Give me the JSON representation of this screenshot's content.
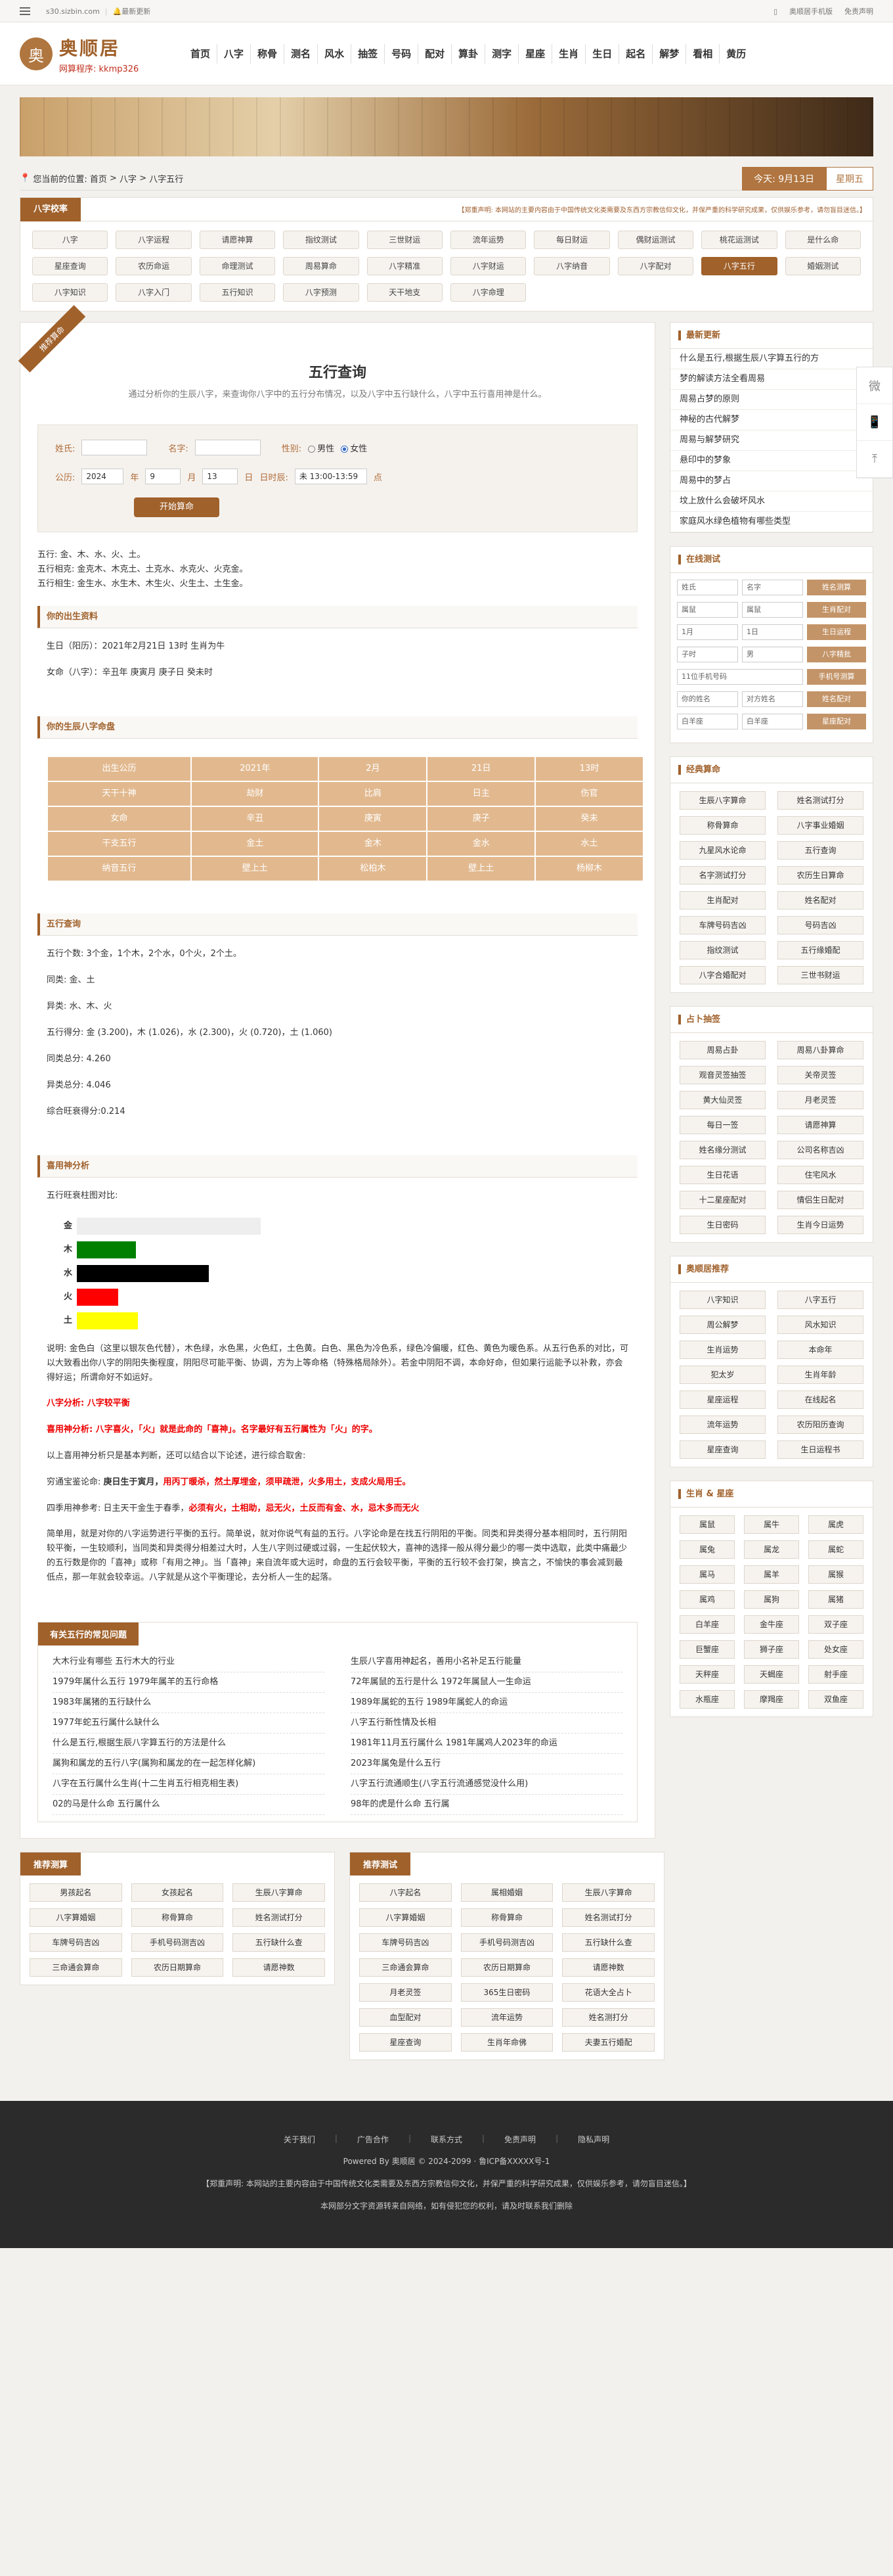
{
  "topbar": {
    "site": "s30.sizbin.com",
    "latest": "最新更新",
    "mobile": "奥顺居手机版",
    "statement": "免责声明"
  },
  "header": {
    "logo_mark": "奥",
    "logo_name": "奥顺居",
    "logo_sub": "网算程序: kkmp326",
    "nav": [
      "首页",
      "八字",
      "称骨",
      "测名",
      "风水",
      "抽签",
      "号码",
      "配对",
      "算卦",
      "测字",
      "星座",
      "生肖",
      "生日",
      "起名",
      "解梦",
      "看相",
      "黄历"
    ]
  },
  "crumb": {
    "label": "您当前的位置:",
    "path": [
      "首页",
      "八字",
      "八字五行"
    ],
    "today": "今天: 9月13日",
    "weekday": "星期五"
  },
  "bazi_panel": {
    "tag": "八字校率",
    "note": "【郑重声明: 本网站的主要内容由于中国传统文化类需要及东西方宗教信仰文化，并保严重的科学研究成果，仅供娱乐参考，请勿盲目迷信。】",
    "items": [
      "八字",
      "八字运程",
      "请愿神算",
      "指纹测试",
      "三世财运",
      "流年运势",
      "每日财运",
      "偶财运测试",
      "桃花运测试",
      "是什么命",
      "星座查询",
      "农历命运",
      "命理测试",
      "周易算命",
      "八字精准",
      "八字财运",
      "八字纳音",
      "八字配对",
      "八字五行",
      "婚姻测试",
      "八字知识",
      "八字入门",
      "五行知识",
      "八字预测",
      "天干地支",
      "八字命理"
    ],
    "active": "八字五行"
  },
  "main": {
    "corner": "推荐算命",
    "title": "五行查询",
    "subtitle": "通过分析你的生辰八字，来查询你八字中的五行分布情况，以及八字中五行缺什么，八字中五行喜用神是什么。",
    "form": {
      "surname": "姓氏:",
      "name": "名字:",
      "gender": "性别:",
      "male": "男性",
      "female": "女性",
      "calendar": "公历:",
      "year": "2024",
      "year_u": "年",
      "month": "9",
      "month_u": "月",
      "day": "13",
      "day_u": "日",
      "time_label": "日时辰:",
      "time": "未 13:00-13:59",
      "time_u": "点",
      "submit": "开始算命"
    },
    "wuxing": [
      "五行: 金、木、水、火、土。",
      "五行相克: 金克木、木克土、土克水、水克火、火克金。",
      "五行相生: 金生水、水生木、木生火、火生土、土生金。"
    ],
    "sec1": {
      "title": "你的出生资料",
      "birth": "生日（阳历）：2021年2月21日 13时 生肖为牛",
      "bazi": "女命（八字）：辛丑年 庚寅月 庚子日 癸未时"
    },
    "sec2": {
      "title": "你的生辰八字命盘",
      "rows": [
        [
          "出生公历",
          "2021年",
          "2月",
          "21日",
          "13时"
        ],
        [
          "天干十神",
          "劫财",
          "比肩",
          "日主",
          "伤官"
        ],
        [
          "女命",
          "辛丑",
          "庚寅",
          "庚子",
          "癸未"
        ],
        [
          "干支五行",
          "金土",
          "金木",
          "金水",
          "水土"
        ],
        [
          "纳音五行",
          "壁上土",
          "松柏木",
          "壁上土",
          "杨柳木"
        ]
      ]
    },
    "sec3": {
      "title": "五行查询",
      "lines": [
        "五行个数: 3个金，1个木，2个水，0个火，2个土。",
        "同类: 金、土",
        "异类: 水、木、火",
        "五行得分: 金 (3.200)，木 (1.026)，水 (2.300)，火 (0.720)，土 (1.060)",
        "同类总分: 4.260",
        "异类总分: 4.046",
        "综合旺衰得分:0.214"
      ]
    },
    "sec4": {
      "title": "喜用神分析",
      "chart_label": "五行旺衰柱图对比:",
      "desc": "说明: 金色白（这里以银灰色代替），木色绿，水色黑，火色红，土色黄。白色、黑色为冷色系，绿色冷偏暖，红色、黄色为暖色系。从五行色系的对比，可以大致看出你八字的阴阳失衡程度，阴阳尽可能平衡、协调，方为上等命格（特殊格局除外）。若金中阴阳不调，本命好命，但如果行运能予以补救，亦会得好运；所谓命好不如运好。",
      "analysis": "八字分析: 八字较平衡",
      "xiyong": "喜用神分析: 八字喜火，「火」就是此命的「喜神」。名字最好有五行属性为「火」的字。",
      "basic": "以上喜用神分析只是基本判断，还可以结合以下论述，进行综合取舍:",
      "xuan_prefix": "穷通宝鉴论命:",
      "xuan_1": "庚日生于寅月，",
      "xuan_2": "用丙丁暖杀，然土厚埋金，须甲疏泄，火多用土，支成火局用壬。",
      "season_prefix": "四季用神参考: 日主天干金生于春季，",
      "season_2": "必须有火，土相助，忌无火，土反而有金、水，忌木多而无火",
      "extra": "简单用，就是对你的八字运势进行平衡的五行。简单说，就对你说气有益的五行。八字论命是在找五行阴阳的平衡。同类和异类得分基本相同时，五行阴阳较平衡，一生较顺利，当同类和异类得分相差过大时，人生八字则过硬或过弱，一生起伏较大，喜神的选择一般从得分最少的哪一类中选取，此类中痛最少的五行数是你的「喜神」或称「有用之神」。当「喜神」来自流年或大运时，命盘的五行会较平衡，平衡的五行较不会打架，换言之，不愉快的事会减到最低点，那一年就会较幸运。八字就是从这个平衡理论，去分析人一生的起落。"
    },
    "chart_data": {
      "type": "bar",
      "title": "五行旺衰柱图对比:",
      "categories": [
        "金",
        "木",
        "水",
        "火",
        "土"
      ],
      "values": [
        3.2,
        1.026,
        2.3,
        0.72,
        1.06
      ],
      "colors": [
        "#eeeeee",
        "#008000",
        "#000000",
        "#ff0000",
        "#ffff00"
      ],
      "orientation": "horizontal"
    },
    "faq": {
      "title": "有关五行的常见问题",
      "items": [
        "大木行业有哪些 五行木大的行业",
        "生辰八字喜用神起名，善用小名补足五行能量",
        "1979年属什么五行 1979年属羊的五行命格",
        "72年属鼠的五行是什么 1972年属鼠人一生命运",
        "1983年属猪的五行缺什么",
        "1989年属蛇的五行 1989年属蛇人的命运",
        "1977年蛇五行属什么缺什么",
        "八字五行新性情及长相",
        "什么是五行,根据生辰八字算五行的方法是什么",
        "1981年11月五行属什么 1981年属鸡人2023年的命运",
        "属狗和属龙的五行八字(属狗和属龙的在一起怎样化解)",
        "2023年属兔是什么五行",
        "八字在五行属什么生肖(十二生肖五行相克相生表)",
        "八字五行流通顺生(八字五行流通感觉没什么用)",
        "02的马是什么命 五行属什么",
        "98年的虎是什么命 五行属"
      ]
    }
  },
  "side": {
    "latest": {
      "title": "最新更新",
      "items": [
        "什么是五行,根据生辰八字算五行的方",
        "梦的解读方法全看周易",
        "周易占梦的原则",
        "神秘的古代解梦",
        "周易与解梦研究",
        "悬印中的梦象",
        "周易中的梦占",
        "坟上放什么会破坏风水",
        "家庭风水绿色植物有哪些类型"
      ]
    },
    "test": {
      "title": "在线测试",
      "surname": "姓氏",
      "name": "名字",
      "b1": "姓名测算",
      "bs1": "属鼠",
      "bs2": "属鼠",
      "b2": "生肖配对",
      "m1": "1月",
      "d1": "1日",
      "b3": "生日运程",
      "t1": "子时",
      "t2": "男",
      "b4": "八字精批",
      "phone": "11位手机号码",
      "b5": "手机号测算",
      "mine": "你的姓名",
      "theirs": "对方姓名",
      "b6": "姓名配对",
      "sg1": "白羊座",
      "sg2": "白羊座",
      "b7": "星座配对"
    },
    "classic": {
      "title": "经典算命",
      "items": [
        "生辰八字算命",
        "姓名测试打分",
        "称骨算命",
        "八字事业婚姻",
        "九星风水论命",
        "五行查询",
        "名字测试打分",
        "农历生日算命",
        "生肖配对",
        "姓名配对",
        "车牌号码吉凶",
        "号码吉凶",
        "指纹测试",
        "五行缘婚配",
        "八字合婚配对",
        "三世书财运"
      ]
    },
    "divine": {
      "title": "占卜抽签",
      "items": [
        "周易占卦",
        "周易八卦算命",
        "观音灵签抽签",
        "关帝灵签",
        "黄大仙灵签",
        "月老灵签",
        "每日一签",
        "请愿神算",
        "姓名缘分测试",
        "公司名称吉凶",
        "生日花语",
        "住宅风水",
        "十二星座配对",
        "情侣生日配对",
        "生日密码",
        "生肖今日运势"
      ]
    },
    "hot": {
      "title": "奥顺居推荐",
      "items": [
        "八字知识",
        "八字五行",
        "周公解梦",
        "风水知识",
        "生肖运势",
        "本命年",
        "犯太岁",
        "生肖年龄",
        "星座运程",
        "在线起名",
        "流年运势",
        "农历阳历查询",
        "星座查询",
        "生日运程书"
      ]
    },
    "zodiac": {
      "title": "生肖 & 星座",
      "items": [
        "属鼠",
        "属牛",
        "属虎",
        "属兔",
        "属龙",
        "属蛇",
        "属马",
        "属羊",
        "属猴",
        "属鸡",
        "属狗",
        "属猪",
        "白羊座",
        "金牛座",
        "双子座",
        "巨蟹座",
        "狮子座",
        "处女座",
        "天秤座",
        "天蝎座",
        "射手座",
        "水瓶座",
        "摩羯座",
        "双鱼座"
      ]
    }
  },
  "rec_left": {
    "title": "推荐测算",
    "items": [
      "男孩起名",
      "女孩起名",
      "生辰八字算命",
      "八字算婚姻",
      "称骨算命",
      "姓名测试打分",
      "车牌号码吉凶",
      "手机号码测吉凶",
      "五行缺什么查",
      "三命通会算命",
      "农历日期算命",
      "请愿神数"
    ]
  },
  "rec_right": {
    "title": "推荐测试",
    "items": [
      "八字起名",
      "属相婚姻",
      "生辰八字算命",
      "八字算婚姻",
      "称骨算命",
      "姓名测试打分",
      "车牌号码吉凶",
      "手机号码测吉凶",
      "五行缺什么查",
      "三命通会算命",
      "农历日期算命",
      "请愿神数",
      "月老灵签",
      "365生日密码",
      "花语大全占卜",
      "血型配对",
      "流年运势",
      "姓名测打分",
      "星座查询",
      "生肖年命佛",
      "夫妻五行婚配"
    ]
  },
  "float": {
    "wechat": "微",
    "phone": "📱",
    "top": "⤒"
  },
  "footer": {
    "links": [
      "关于我们",
      "广告合作",
      "联系方式",
      "免责声明",
      "隐私声明"
    ],
    "power": "Powered By 奥顺居 © 2024-2099 · 鲁ICP备XXXXX号-1",
    "note": "【郑重声明: 本网站的主要内容由于中国传统文化类需要及东西方宗教信仰文化，并保严重的科学研究成果，仅供娱乐参考，请勿盲目迷信。】",
    "copy": "本网部分文字资源转来自网络，如有侵犯您的权利，请及时联系我们删除"
  }
}
